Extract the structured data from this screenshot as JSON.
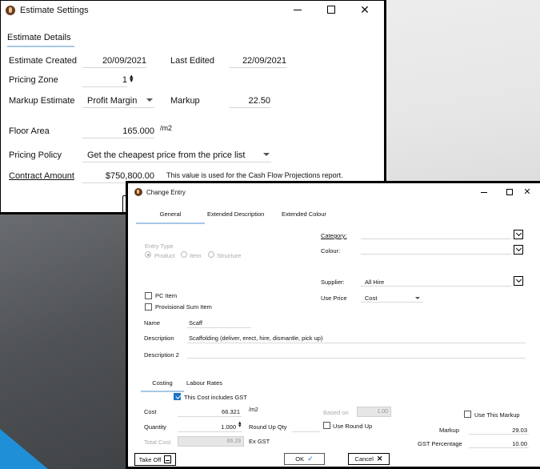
{
  "estimate_window": {
    "title": "Estimate Settings",
    "tab": "Estimate Details",
    "estimate_created_label": "Estimate Created",
    "estimate_created": "20/09/2021",
    "last_edited_label": "Last Edited",
    "last_edited": "22/09/2021",
    "pricing_zone_label": "Pricing Zone",
    "pricing_zone": "1",
    "markup_estimate_label": "Markup Estimate",
    "markup_estimate": "Profit Margin",
    "markup_label": "Markup",
    "markup": "22.50",
    "floor_area_label": "Floor Area",
    "floor_area": "165.000",
    "floor_area_unit": "/m2",
    "pricing_policy_label": "Pricing Policy",
    "pricing_policy": "Get the cheapest price from the price list",
    "contract_amount_label": "Contract Amount",
    "contract_amount": "$750,800.00",
    "contract_note": "This value is used for the Cash Flow Projections report."
  },
  "change_entry": {
    "title": "Change Entry",
    "tabs": [
      "General",
      "Extended Description",
      "Extended Colour"
    ],
    "entry_type_label": "Entry Type",
    "entry_types": [
      "Product",
      "Item",
      "Structure"
    ],
    "category_label": "Category:",
    "colour_label": "Colour:",
    "supplier_label": "Supplier:",
    "supplier": "All Hire",
    "use_price_label": "Use Price",
    "use_price": "Cost",
    "pc_item_label": "PC Item",
    "provisional_label": "Provisional Sum Item",
    "name_label": "Name",
    "name": "Scaff",
    "description_label": "Description",
    "description": "Scaffolding (deliver, erect, hire, dismantle, pick up)",
    "description2_label": "Description 2",
    "sub_tabs": [
      "Costing",
      "Labour Rates"
    ],
    "includes_gst_label": "This Cost includes GST",
    "cost_label": "Cost",
    "cost": "66.321",
    "cost_unit": "/m2",
    "based_on_label": "Based on",
    "based_on": "1.00",
    "quantity_label": "Quantity",
    "quantity": "1.000",
    "round_up_qty_label": "Round Up Qty",
    "use_round_up_label": "Use Round Up",
    "total_cost_label": "Total Cost",
    "total_cost": "66.29",
    "ex_gst_label": "Ex GST",
    "use_this_markup_label": "Use This Markup",
    "markup_label": "Markup",
    "markup": "29.03",
    "gst_pct_label": "GST Percentage",
    "gst_pct": "10.00",
    "take_off_label": "Take Off",
    "ok_label": "OK",
    "cancel_label": "Cancel"
  }
}
